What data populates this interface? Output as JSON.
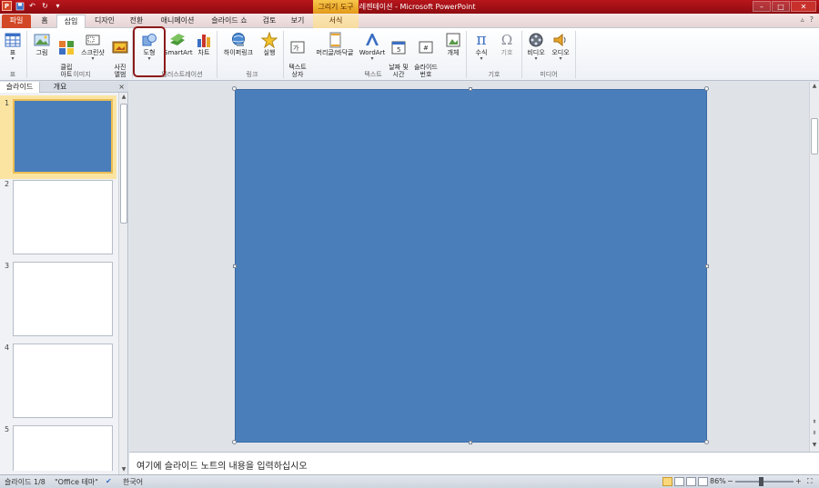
{
  "titlebar": {
    "title": "새 프레젠테이션 - Microsoft PowerPoint",
    "context_title": "그리기 도구",
    "app_logo": "P",
    "window_buttons": [
      "–",
      "□",
      "✕"
    ]
  },
  "tabs": {
    "file": "파일",
    "home": "홈",
    "insert": "삽입",
    "design": "디자인",
    "transitions": "전환",
    "animations": "애니메이션",
    "slideshow": "슬라이드 쇼",
    "review": "검토",
    "view": "보기",
    "format": "서식"
  },
  "ribbon": {
    "table": "표",
    "picture": "그림",
    "clipart": "클립\n아트",
    "screenshot": "스크린샷",
    "photo_album": "사진\n앨범",
    "shapes": "도형",
    "smartart": "SmartArt",
    "chart": "차트",
    "hyperlink": "하이퍼링크",
    "action": "실행",
    "textbox": "텍스트\n상자",
    "header_footer": "머리글/바닥글",
    "wordart": "WordArt",
    "datetime": "날짜 및\n시간",
    "slide_number": "슬라이드\n번호",
    "object": "개체",
    "equation": "수식",
    "symbol": "기호",
    "video": "비디오",
    "audio": "오디오",
    "groups": {
      "tables": "표",
      "images": "이미지",
      "illustrations": "일러스트레이션",
      "links": "링크",
      "text": "텍스트",
      "symbols": "기호",
      "media": "미디어"
    }
  },
  "panel": {
    "tab_slides": "슬라이드",
    "tab_outline": "개요",
    "close": "×",
    "thumbnails": [
      "1",
      "2",
      "3",
      "4",
      "5"
    ]
  },
  "notes": {
    "placeholder": "여기에 슬라이드 노트의 내용을 입력하십시오"
  },
  "status": {
    "slide_info": "슬라이드 1/8",
    "theme": "\"Office 테마\"",
    "language": "한국어",
    "zoom": "86%",
    "zoom_minus": "−",
    "zoom_plus": "+"
  },
  "colors": {
    "slide_fill": "#4a7ebb",
    "file_tab": "#d24726",
    "title_bar": "#b8161c",
    "highlight": "#8c1a1a"
  }
}
